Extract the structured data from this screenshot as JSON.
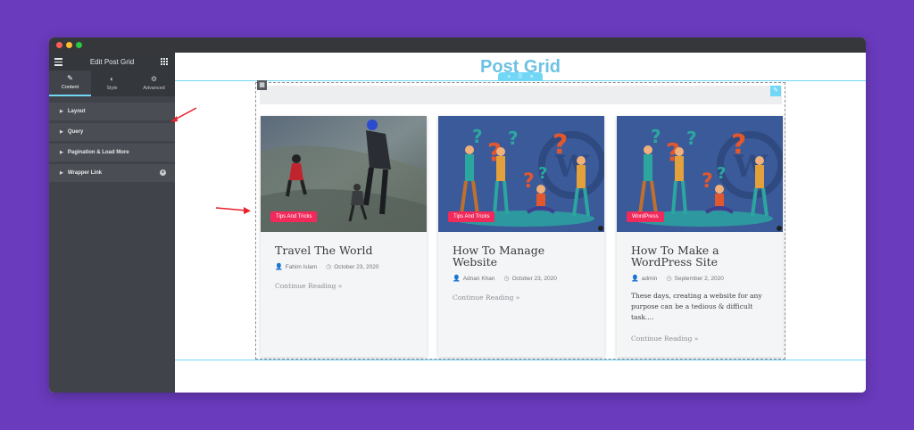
{
  "sidebar": {
    "title": "Edit Post Grid",
    "tabs": [
      {
        "label": "Content",
        "icon": "pencil-icon"
      },
      {
        "label": "Style",
        "icon": "contrast-icon"
      },
      {
        "label": "Advanced",
        "icon": "gear-icon"
      }
    ],
    "sections": [
      {
        "label": "Layout"
      },
      {
        "label": "Query"
      },
      {
        "label": "Pagination & Load More"
      },
      {
        "label": "Wrapper Link"
      }
    ]
  },
  "canvas": {
    "page_title": "Post Grid"
  },
  "posts": [
    {
      "category": "Tips And Tricks",
      "title": "Travel The World",
      "author": "Fahim Islam",
      "date": "October 23, 2020",
      "excerpt": "",
      "read_more": "Continue Reading »"
    },
    {
      "category": "Tips And Tricks",
      "title": "How To Manage Website",
      "author": "Adnan Khan",
      "date": "October 23, 2020",
      "excerpt": "",
      "read_more": "Continue Reading »"
    },
    {
      "category": "WordPress",
      "title": "How To Make a WordPress Site",
      "author": "admin",
      "date": "September 2, 2020",
      "excerpt": "These days, creating a website for any purpose can be a tedious & difficult task....",
      "read_more": "Continue Reading »"
    }
  ],
  "colors": {
    "background": "#6a3bbd",
    "accent": "#71d7f7",
    "badge": "#f2295b",
    "title": "#6ec1e4",
    "arrow": "#e8212b"
  }
}
